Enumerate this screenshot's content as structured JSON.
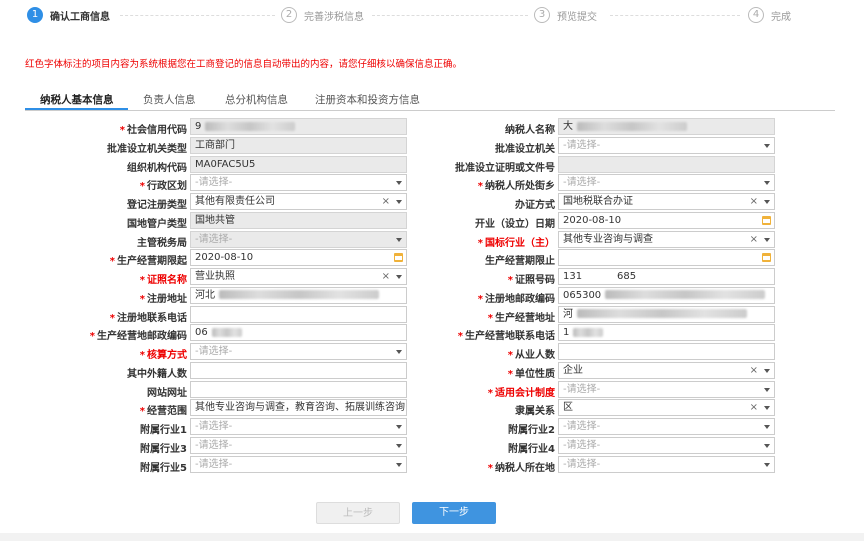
{
  "steps": [
    {
      "num": "1",
      "label": "确认工商信息"
    },
    {
      "num": "2",
      "label": "完善涉税信息"
    },
    {
      "num": "3",
      "label": "预览提交"
    },
    {
      "num": "4",
      "label": "完成"
    }
  ],
  "notice": "红色字体标注的项目内容为系统根据您在工商登记的信息自动带出的内容，请您仔细核以确保信息正确。",
  "tabs": [
    "纳税人基本信息",
    "负责人信息",
    "总分机构信息",
    "注册资本和投资方信息"
  ],
  "placeholder": "-请选择-",
  "rows": [
    {
      "l_label": "社会信用代码",
      "l_value": "9",
      "r_label": "纳税人名称",
      "r_value": "大"
    },
    {
      "l_label": "批准设立机关类型",
      "l_value": "工商部门",
      "r_label": "批准设立机关",
      "r_value": ""
    },
    {
      "l_label": "组织机构代码",
      "l_value": "MA0FAC5U5",
      "r_label": "批准设立证明或文件号",
      "r_value": ""
    },
    {
      "l_label": "行政区划",
      "l_value": "",
      "r_label": "纳税人所处街乡",
      "r_value": ""
    },
    {
      "l_label": "登记注册类型",
      "l_value": "其他有限责任公司",
      "r_label": "办证方式",
      "r_value": "国地税联合办证"
    },
    {
      "l_label": "国地管户类型",
      "l_value": "国地共管",
      "r_label": "开业（设立）日期",
      "r_value": "2020-08-10"
    },
    {
      "l_label": "主管税务局",
      "l_value": "",
      "r_label": "国标行业（主）",
      "r_value": "其他专业咨询与调查"
    },
    {
      "l_label": "生产经营期限起",
      "l_value": "2020-08-10",
      "r_label": "生产经营期限止",
      "r_value": ""
    },
    {
      "l_label": "证照名称",
      "l_value": "营业执照",
      "r_label": "证照号码",
      "r_value": "131           685"
    },
    {
      "l_label": "注册地址",
      "l_value": "河北",
      "r_label": "注册地邮政编码",
      "r_value": "065300"
    },
    {
      "l_label": "注册地联系电话",
      "l_value": "",
      "r_label": "生产经营地址",
      "r_value": "河"
    },
    {
      "l_label": "生产经营地邮政编码",
      "l_value": "06",
      "r_label": "生产经营地联系电话",
      "r_value": "1"
    },
    {
      "l_label": "核算方式",
      "l_value": "",
      "r_label": "从业人数",
      "r_value": ""
    },
    {
      "l_label": "其中外籍人数",
      "l_value": "",
      "r_label": "单位性质",
      "r_value": "企业"
    },
    {
      "l_label": "网站网址",
      "l_value": "",
      "r_label": "适用会计制度",
      "r_value": ""
    },
    {
      "l_label": "经营范围",
      "l_value": "其他专业咨询与调查，教育咨询、拓展训练咨询（",
      "r_label": "隶属关系",
      "r_value": "区"
    },
    {
      "l_label": "附属行业1",
      "l_value": "",
      "r_label": "附属行业2",
      "r_value": ""
    },
    {
      "l_label": "附属行业3",
      "l_value": "",
      "r_label": "附属行业4",
      "r_value": ""
    },
    {
      "l_label": "附属行业5",
      "l_value": "",
      "r_label": "纳税人所在地",
      "r_value": ""
    }
  ],
  "buttons": {
    "prev": "上一步",
    "next": "下一步"
  },
  "colors": {
    "accent": "#2f8fe6",
    "required": "#e00000",
    "readonly_bg": "#eaeaea"
  }
}
